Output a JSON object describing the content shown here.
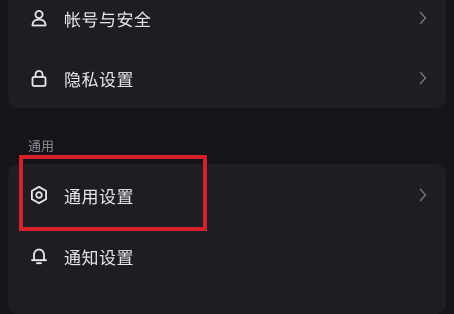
{
  "account_section": {
    "items": [
      {
        "label": "帐号与安全",
        "icon": "person-icon"
      },
      {
        "label": "隐私设置",
        "icon": "lock-icon"
      }
    ]
  },
  "general_section": {
    "title": "通用",
    "items": [
      {
        "label": "通用设置",
        "icon": "gear-icon"
      },
      {
        "label": "通知设置",
        "icon": "bell-icon"
      }
    ]
  },
  "colors": {
    "background": "#141419",
    "card": "#1d1d24",
    "text": "#e8e8ec",
    "section_text": "#8c8c96",
    "highlight": "#d8202c"
  }
}
